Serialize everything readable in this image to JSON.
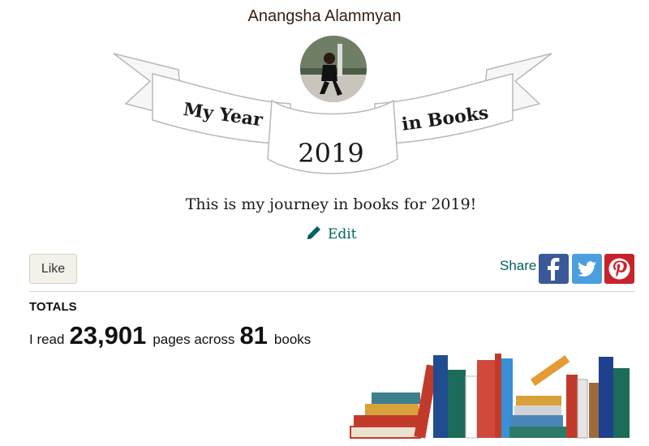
{
  "profile": {
    "name": "Anangsha Alammyan"
  },
  "banner": {
    "left_text": "My Year",
    "right_text": "in Books",
    "year": "2019"
  },
  "tagline": "This is my journey in books for 2019!",
  "actions": {
    "edit_label": "Edit",
    "like_label": "Like",
    "share_label": "Share",
    "share_targets": [
      "facebook",
      "twitter",
      "pinterest"
    ]
  },
  "totals": {
    "heading": "TOTALS",
    "prefix": "I read",
    "pages": "23,901",
    "middle": "pages across",
    "books": "81",
    "suffix": "books"
  },
  "colors": {
    "accent_green": "#00635d",
    "facebook": "#3b5998",
    "twitter": "#4b9fdf",
    "pinterest": "#c8232c"
  },
  "icons": {
    "edit": "pencil-icon",
    "facebook": "facebook-icon",
    "twitter": "twitter-icon",
    "pinterest": "pinterest-icon"
  }
}
